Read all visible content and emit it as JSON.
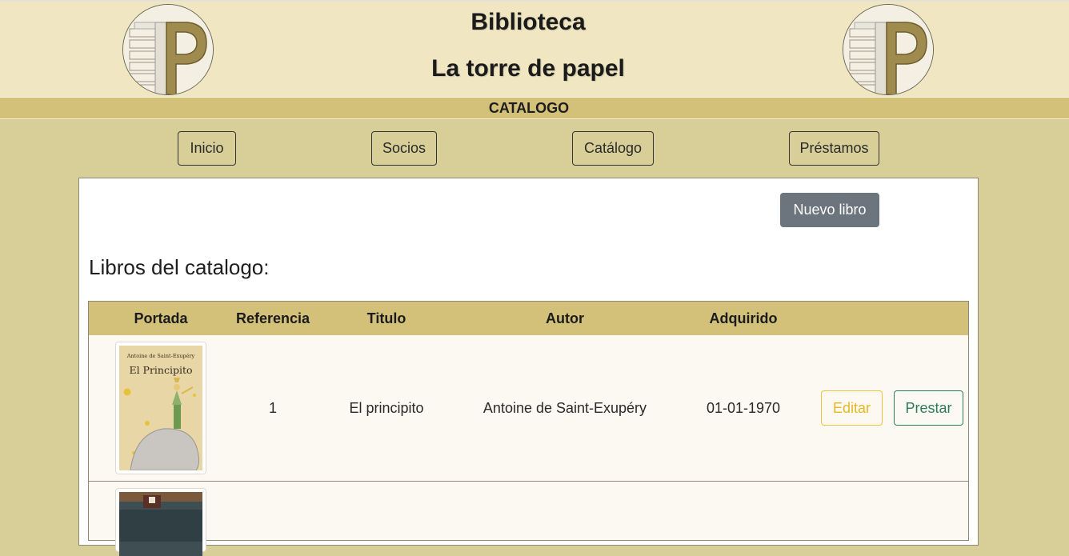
{
  "header": {
    "title_line1": "Biblioteca",
    "title_line2": "La torre de papel",
    "logo_letter": "P"
  },
  "section_bar": {
    "label": "CATALOGO"
  },
  "nav": {
    "items": [
      {
        "label": "Inicio"
      },
      {
        "label": "Socios"
      },
      {
        "label": "Catálogo"
      },
      {
        "label": "Préstamos"
      }
    ]
  },
  "main": {
    "new_book_button": "Nuevo libro",
    "heading": "Libros del catalogo:",
    "table": {
      "columns": [
        "Portada",
        "Referencia",
        "Titulo",
        "Autor",
        "Adquirido"
      ],
      "rows": [
        {
          "cover_text_top": "Antoine de Saint-Exupéry",
          "cover_text_title": "El Principito",
          "referencia": "1",
          "titulo": "El principito",
          "autor": "Antoine de Saint-Exupéry",
          "adquirido": "01-01-1970",
          "edit_label": "Editar",
          "lend_label": "Prestar"
        }
      ]
    }
  },
  "colors": {
    "page_bg": "#d8cf98",
    "header_bg": "#f0e6c1",
    "bar_bg": "#d3c17a",
    "secondary_button": "#6c757d",
    "warning": "#f0c237",
    "success": "#2e7d5a"
  }
}
